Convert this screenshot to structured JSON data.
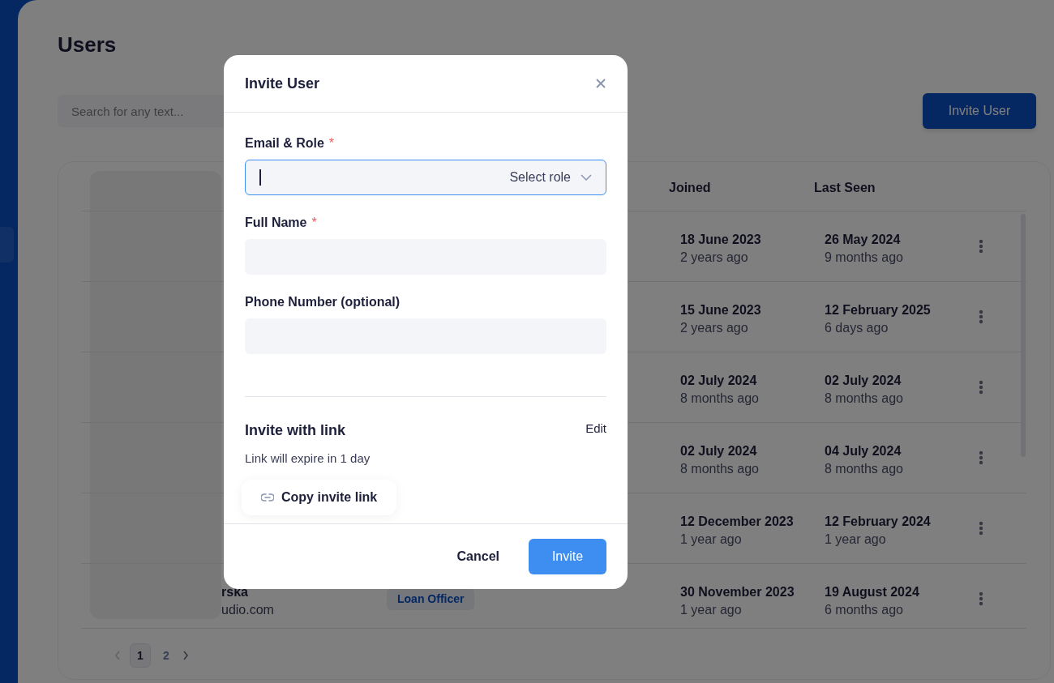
{
  "page": {
    "title": "Users",
    "search": {
      "placeholder": "Search for any text..."
    },
    "invite_button": "Invite User"
  },
  "table": {
    "columns": [
      "Joined",
      "Last Seen"
    ],
    "rows": [
      {
        "joined": "18 June 2023",
        "joined_ago": "2 years ago",
        "last_seen": "26 May 2024",
        "last_seen_ago": "9 months ago"
      },
      {
        "joined": "15 June 2023",
        "joined_ago": "2 years ago",
        "last_seen": "12 February 2025",
        "last_seen_ago": "6 days ago"
      },
      {
        "joined": "02 July 2024",
        "joined_ago": "8 months ago",
        "last_seen": "02 July 2024",
        "last_seen_ago": "8 months ago"
      },
      {
        "joined": "02 July 2024",
        "joined_ago": "8 months ago",
        "last_seen": "04 July 2024",
        "last_seen_ago": "8 months ago"
      },
      {
        "joined": "12 December 2023",
        "joined_ago": "1 year ago",
        "last_seen": "12 February 2024",
        "last_seen_ago": "1 year ago"
      },
      {
        "name": "rska",
        "email": "udio.com",
        "role": "Loan Officer",
        "joined": "30 November 2023",
        "joined_ago": "1 year ago",
        "last_seen": "19 August 2024",
        "last_seen_ago": "6 months ago"
      }
    ]
  },
  "pagination": [
    {
      "label": "1",
      "selected": true
    },
    {
      "label": "2",
      "selected": false
    }
  ],
  "modal": {
    "title": "Invite User",
    "fields": [
      {
        "kind": "email_role",
        "label": "Email & Role",
        "required_mark": "*",
        "focused": true,
        "select": "Select role"
      },
      {
        "kind": "text",
        "label": "Full Name",
        "required_mark": "*",
        "focused": false
      },
      {
        "kind": "text",
        "label": "Phone Number (optional)",
        "focused": false
      }
    ],
    "link_section": {
      "title": "Invite with link",
      "edit": "Edit",
      "note": "Link will expire in 1 day",
      "copy_button": "Copy invite link"
    },
    "buttons": {
      "cancel": "Cancel",
      "confirm": "Invite"
    }
  }
}
